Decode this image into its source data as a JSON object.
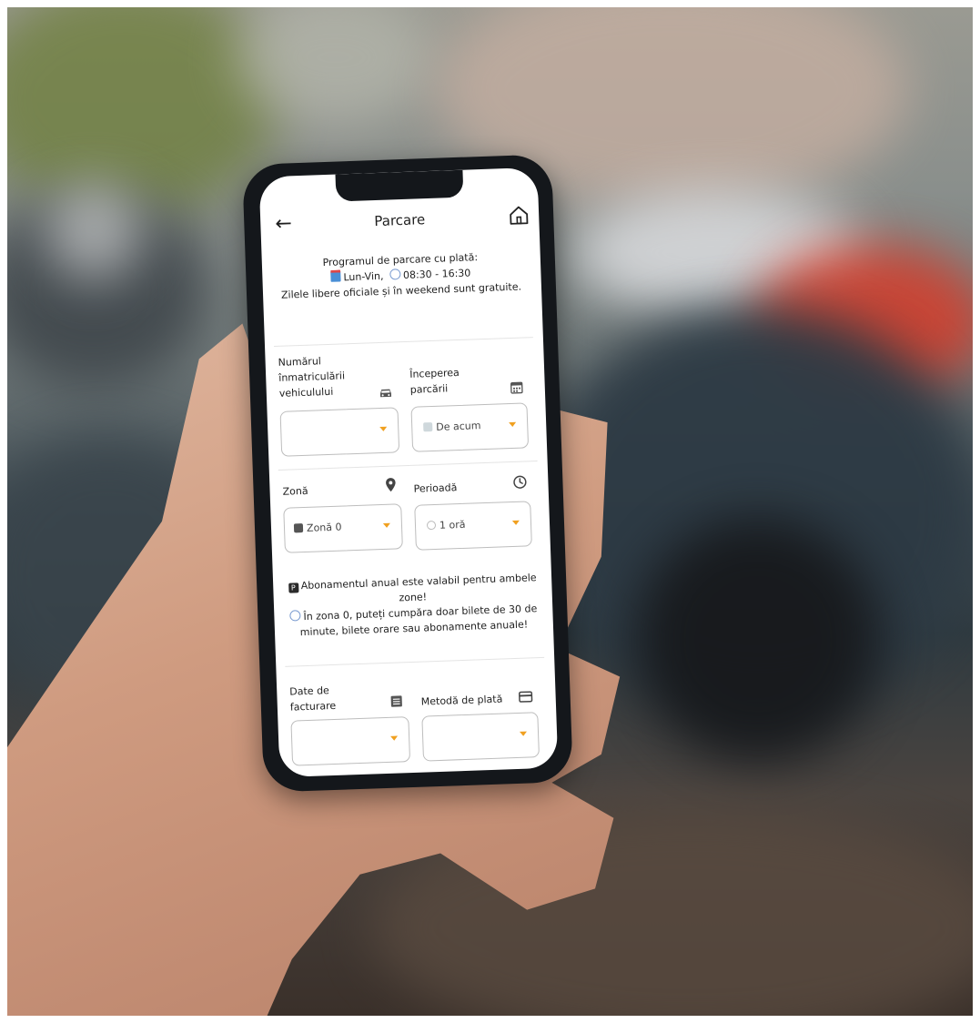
{
  "app": {
    "title": "Parcare",
    "back_icon": "arrow-left-icon",
    "home_icon": "home-icon"
  },
  "notice": {
    "line1": "Programul de parcare cu plată:",
    "days": "Lun-Vin,",
    "hours": "08:30 - 16:30",
    "line3": "Zilele libere oficiale și în weekend sunt gratuite."
  },
  "form": {
    "vehicle": {
      "label": "Numărul înmatriculării vehiculului",
      "icon": "car-icon",
      "value": ""
    },
    "start": {
      "label": "Începerea parcării",
      "icon": "calendar-icon",
      "value": "De acum"
    },
    "zone": {
      "label": "Zonă",
      "icon": "location-pin-icon",
      "value": "Zonă 0"
    },
    "period": {
      "label": "Perioadă",
      "icon": "clock-icon",
      "value": "1 oră"
    },
    "billing": {
      "label": "Date de facturare",
      "icon": "list-icon",
      "value": ""
    },
    "payment": {
      "label": "Metodă de plată",
      "icon": "credit-card-icon",
      "value": ""
    }
  },
  "info": {
    "line1": "Abonamentul anual este valabil pentru ambele zone!",
    "line2": "În zona 0, puteți cumpăra doar bilete de 30 de minute, bilete orare sau abonamente anuale!"
  },
  "colors": {
    "accent": "#f0a020",
    "phone_frame": "#14171b"
  }
}
